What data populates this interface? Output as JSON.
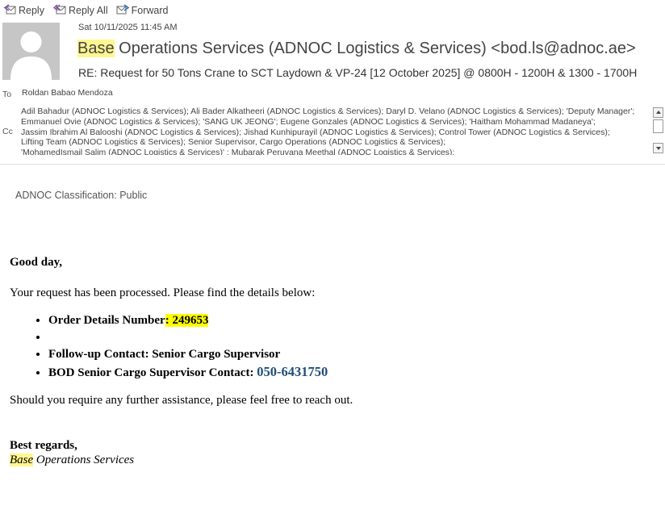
{
  "toolbar": {
    "reply_label": "Reply",
    "reply_all_label": "Reply All",
    "forward_label": "Forward"
  },
  "header": {
    "sent_date": "Sat 10/11/2025 11:45 AM",
    "sender_highlight": "Base",
    "sender_rest": " Operations Services (ADNOC Logistics & Services) <bod.ls@adnoc.ae>",
    "subject": "RE: Request for 50 Tons Crane to SCT Laydown & VP-24 [12 October 2025] @ 0800H - 1200H & 1300 - 1700H",
    "to_label": "To",
    "to_value": "Roldan Babao Mendoza",
    "cc_label": "Cc",
    "cc_lines": [
      "Adil  Bahadur (ADNOC Logistics & Services); Ali Bader Alkatheeri (ADNOC Logistics & Services); Daryl D. Velano (ADNOC Logistics & Services); 'Deputy Manager';",
      "Emmanuel Ovie (ADNOC Logistics & Services); 'SANG UK JEONG'; Eugene Gonzales (ADNOC Logistics & Services); 'Haitham Mohammad Madaneya';",
      "Jassim Ibrahim Al Balooshi (ADNOC Logistics & Services); Jishad Kunhipurayil (ADNOC Logistics & Services); Control Tower (ADNOC Logistics & Services);",
      "Lifting Team (ADNOC Logistics & Services); Senior Supervisor, Cargo Operations (ADNOC Logistics & Services);",
      "'MohamedIsmail Salim (ADNOC Logistics & Services)'    ; Mubarak Peruvana Meethal (ADNOC Logistics & Services);"
    ]
  },
  "body": {
    "classification": "ADNOC Classification: Public",
    "greeting": "Good day,",
    "intro": "Your request has been processed. Please find the details below:",
    "details": {
      "order_label": "Order Details Number",
      "order_value": ": 249653",
      "empty_item": "",
      "followup": "Follow-up Contact: Senior Cargo Supervisor",
      "bod_label": "BOD Senior Cargo Supervisor Contact: ",
      "bod_phone": "050-6431750"
    },
    "closing": "Should you require any further assistance, please feel free to reach out.",
    "regards": "Best regards,",
    "signature_highlight": "Base",
    "signature_rest": " Operations Services"
  },
  "colors": {
    "sender_highlight": "#fff68f",
    "order_highlight": "#ffff00",
    "phone_link": "#1f4e79"
  }
}
